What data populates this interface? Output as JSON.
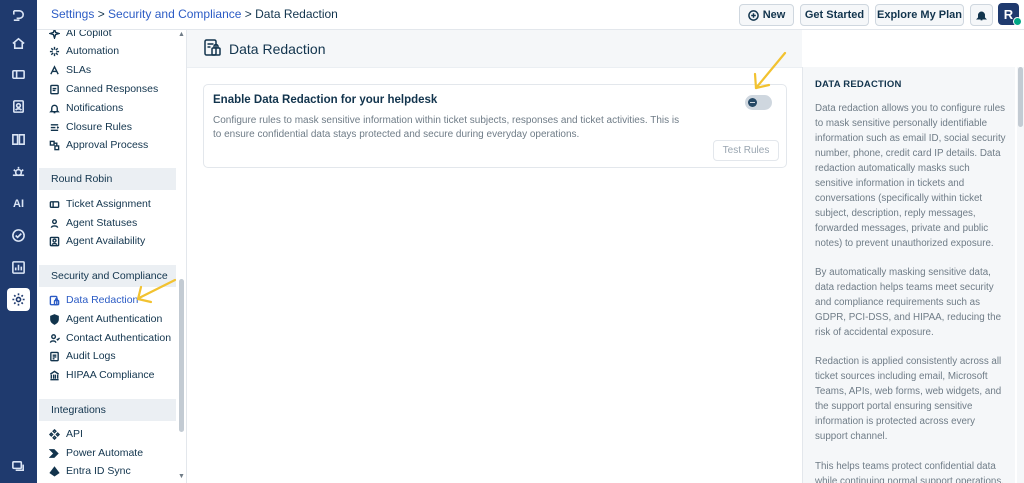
{
  "breadcrumb": {
    "settings": "Settings",
    "sep1": " > ",
    "section": "Security and Compliance",
    "sep2": " > ",
    "current": "Data Redaction"
  },
  "topbar": {
    "new_label": "New",
    "get_started_label": "Get Started",
    "explore_label": "Explore My Plan",
    "avatar_initial": "R"
  },
  "rail": {
    "ai_label": "AI"
  },
  "sidebar": {
    "items_top": [
      {
        "label": "AI Copilot",
        "icon": "sparkle-icon"
      },
      {
        "label": "Automation",
        "icon": "automation-icon"
      },
      {
        "label": "SLAs",
        "icon": "sla-icon"
      },
      {
        "label": "Canned Responses",
        "icon": "canned-icon"
      },
      {
        "label": "Notifications",
        "icon": "bell-icon"
      },
      {
        "label": "Closure Rules",
        "icon": "closure-icon"
      },
      {
        "label": "Approval Process",
        "icon": "approval-icon"
      }
    ],
    "group_round_robin": "Round Robin",
    "items_rr": [
      {
        "label": "Ticket Assignment"
      },
      {
        "label": "Agent Statuses"
      },
      {
        "label": "Agent Availability"
      }
    ],
    "group_security": "Security and Compliance",
    "items_sec": [
      {
        "label": "Data Redaction"
      },
      {
        "label": "Agent Authentication"
      },
      {
        "label": "Contact Authentication"
      },
      {
        "label": "Audit Logs"
      },
      {
        "label": "HIPAA Compliance"
      }
    ],
    "group_integrations": "Integrations",
    "items_int": [
      {
        "label": "API"
      },
      {
        "label": "Power Automate"
      },
      {
        "label": "Entra ID Sync"
      }
    ]
  },
  "page": {
    "title": "Data Redaction"
  },
  "card": {
    "title": "Enable Data Redaction for your helpdesk",
    "description": "Configure rules to mask sensitive information within ticket subjects, responses and ticket activities. This is to ensure confidential data stays protected and secure during everyday operations.",
    "toggle_on": false,
    "test_rules_label": "Test Rules"
  },
  "info": {
    "heading": "DATA REDACTION",
    "p1": "Data redaction allows you to configure rules to mask sensitive personally identifiable information such as email ID, social security number, phone, credit card IP details. Data redaction automatically masks such sensitive information in tickets and conversations (specifically within ticket subject, description, reply messages, forwarded messages, private and public notes) to prevent unauthorized exposure.",
    "p2": "By automatically masking sensitive data, data redaction helps teams meet security and compliance requirements such as GDPR, PCI-DSS, and HIPAA, reducing the risk of accidental exposure.",
    "p3": "Redaction is applied consistently across all ticket sources including email, Microsoft Teams, APIs, web forms, web widgets, and the support portal ensuring sensitive information is protected across every support channel.",
    "p4": "This helps teams protect confidential data while continuing normal support operations."
  },
  "colors": {
    "rail": "#1f3a6e",
    "accent": "#2c5cc5",
    "annotation": "#f2c230"
  }
}
